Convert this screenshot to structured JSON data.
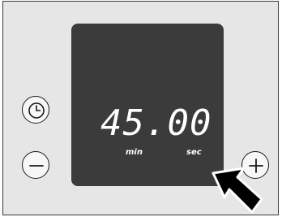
{
  "display": {
    "time": "45.00",
    "unit_min": "min",
    "unit_sec": "sec"
  },
  "colors": {
    "panel": "#e6e6e6",
    "display_background": "#3b3b3b",
    "digits": "#ffffff",
    "button_outline": "#1a1a1a"
  },
  "icons": {
    "clock": "clock-icon",
    "minus": "minus-icon",
    "plus": "plus-icon",
    "pointer": "pointing-arrow"
  }
}
